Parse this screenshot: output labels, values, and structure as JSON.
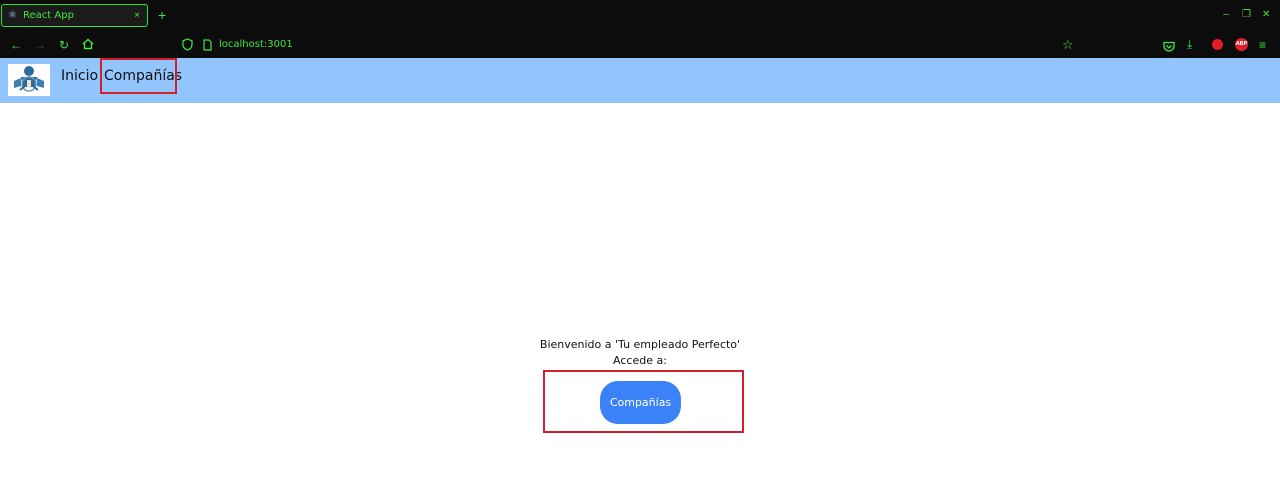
{
  "browser": {
    "tab": {
      "title": "React App",
      "favicon": "react-atom-icon",
      "close": "×"
    },
    "new_tab": "+",
    "window_controls": [
      "–",
      "❐",
      "✕"
    ],
    "url": "localhost:3001",
    "accent_color": "#3ee83e"
  },
  "header": {
    "background": "#93c5fd",
    "nav": [
      {
        "label": "Inicio"
      },
      {
        "label": "Compañías"
      }
    ]
  },
  "main": {
    "welcome_text": "Bienvenido a 'Tu empleado Perfecto'",
    "access_text": "Accede a:",
    "cta_label": "Compañías",
    "cta_color": "#3b82f6"
  },
  "annotations": {
    "highlight_color": "#d11f2c"
  }
}
